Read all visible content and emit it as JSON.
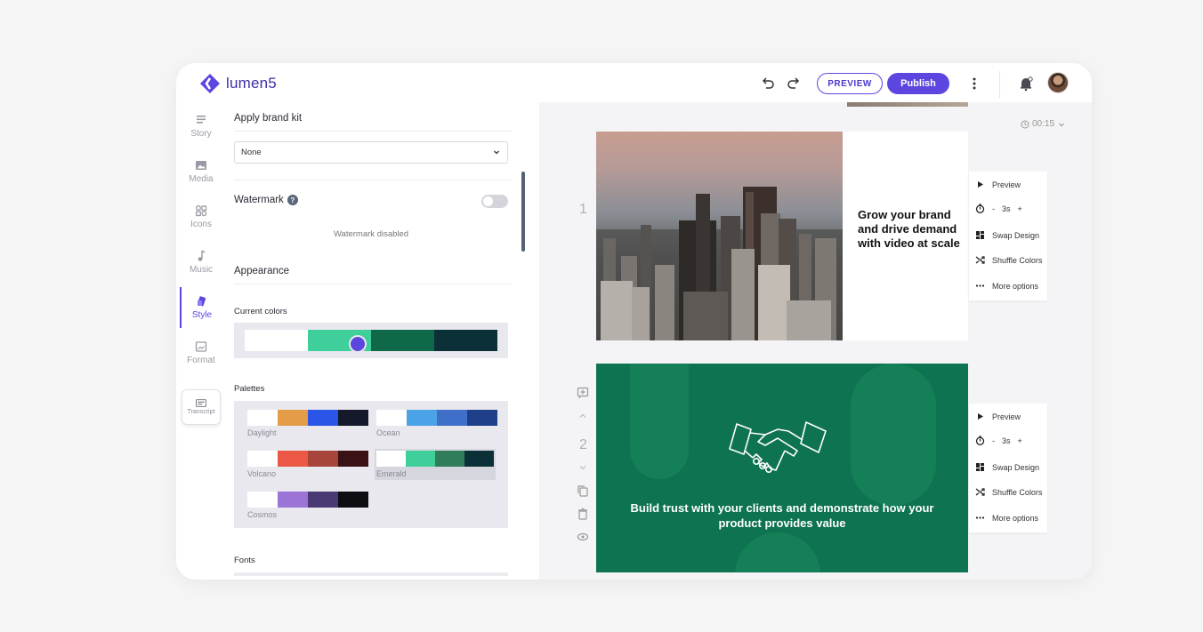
{
  "app": {
    "logo_text": "lumen5"
  },
  "header": {
    "preview_label": "PREVIEW",
    "publish_label": "Publish"
  },
  "nav": {
    "story": "Story",
    "media": "Media",
    "icons": "Icons",
    "music": "Music",
    "style": "Style",
    "format": "Format",
    "transcript": "Transcript"
  },
  "panel": {
    "brand_kit_heading": "Apply brand kit",
    "brand_kit_value": "None",
    "watermark_label": "Watermark",
    "watermark_help": "?",
    "watermark_status": "Watermark disabled",
    "appearance_heading": "Appearance",
    "current_colors_label": "Current colors",
    "current_colors": [
      "#ffffff",
      "#3ecf9a",
      "#0f6848",
      "#0c3038"
    ],
    "palettes_label": "Palettes",
    "palettes": [
      {
        "name": "Daylight",
        "colors": [
          "#ffffff",
          "#e59c48",
          "#2a55e6",
          "#141a2c"
        ]
      },
      {
        "name": "Ocean",
        "colors": [
          "#ffffff",
          "#4aa3e6",
          "#3f6fc8",
          "#1f3f88"
        ]
      },
      {
        "name": "Volcano",
        "colors": [
          "#ffffff",
          "#ec5846",
          "#a8453a",
          "#3a1216"
        ]
      },
      {
        "name": "Emerald",
        "colors": [
          "#ffffff",
          "#3ecf9a",
          "#2f7d5a",
          "#0c3038"
        ]
      },
      {
        "name": "Cosmos",
        "colors": [
          "#ffffff",
          "#9b74d6",
          "#4a3a74",
          "#0d0d12"
        ]
      }
    ],
    "fonts_heading": "Fonts"
  },
  "canvas": {
    "duration": "00:15",
    "scene1": {
      "number": "1",
      "headline": "Grow your brand and drive demand with video at scale"
    },
    "scene2": {
      "number": "2",
      "caption": "Build trust with your clients and demonstrate how your product provides value"
    },
    "options": {
      "preview": "Preview",
      "timing_minus": "-",
      "timing_value": "3s",
      "timing_plus": "+",
      "swap_design": "Swap Design",
      "shuffle_colors": "Shuffle Colors",
      "more_options": "More options"
    }
  },
  "colors": {
    "accent": "#5b47e0",
    "scene_green": "#0e7350"
  }
}
